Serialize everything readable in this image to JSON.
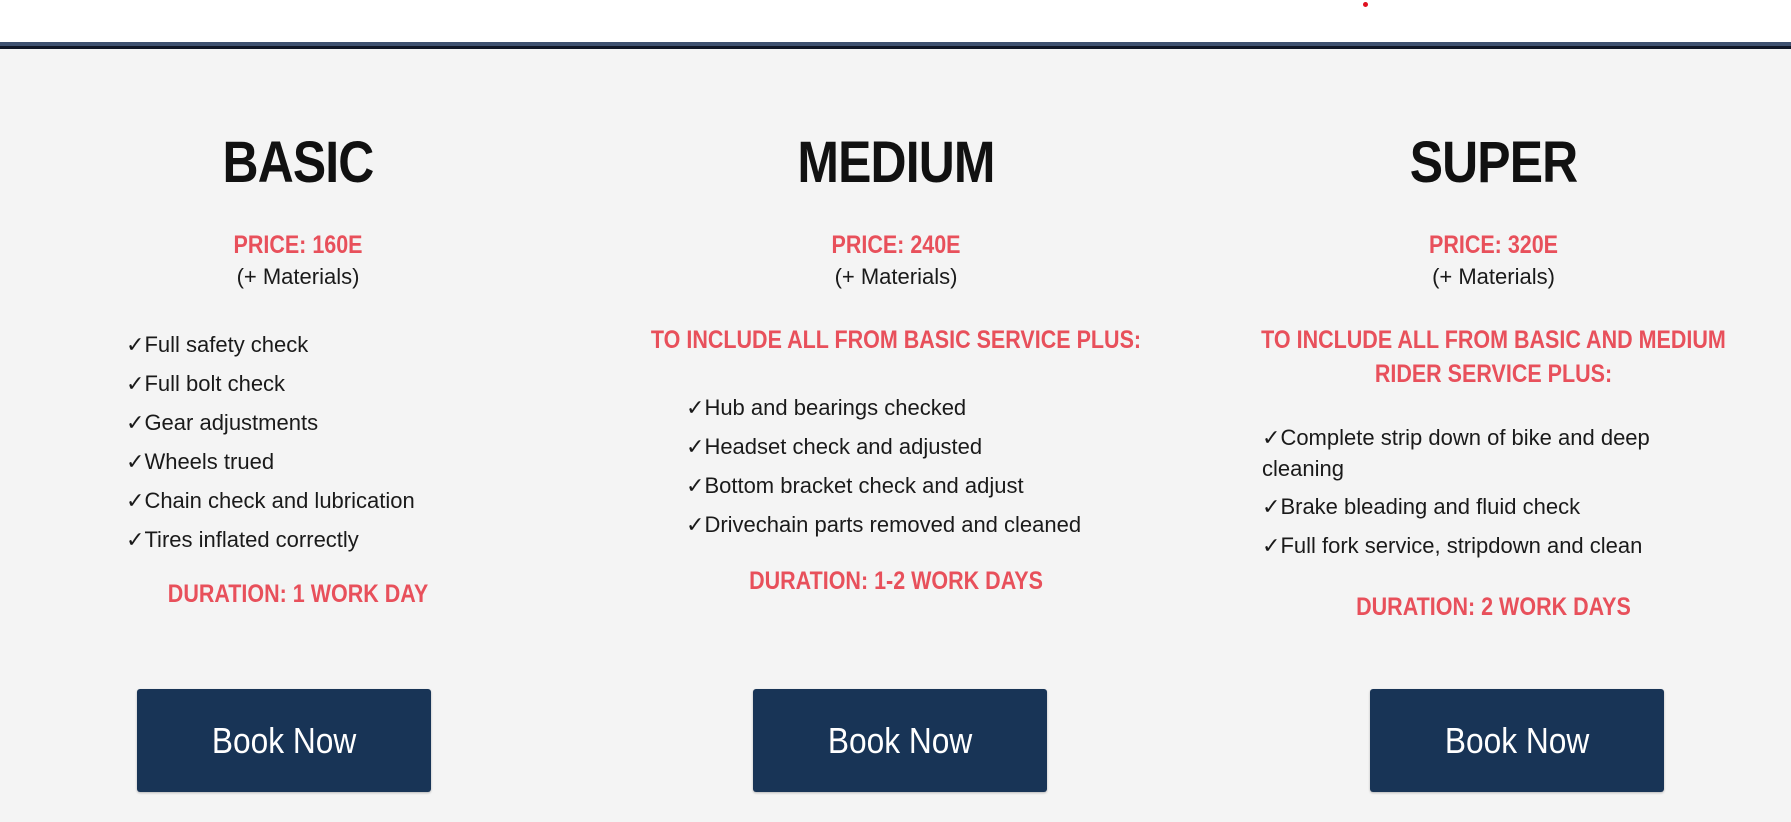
{
  "colors": {
    "accent": "#e8505b",
    "button_bg": "#183456",
    "header_bg": "#ffffff",
    "header_line": "#3e5170",
    "page_bg": "#f4f4f4",
    "dot": "#e01020"
  },
  "check_icon": "check-icon",
  "check_glyph": "✓",
  "plans": [
    {
      "name": "BASIC",
      "price": "PRICE: 160E",
      "materials": "(+ Materials)",
      "features": [
        "Full safety check",
        "Full bolt check",
        "Gear adjustments",
        "Wheels trued",
        "Chain check and lubrication",
        "Tires inflated correctly"
      ],
      "duration": "DURATION: 1 WORK DAY",
      "button_label": "Book Now"
    },
    {
      "name": "MEDIUM",
      "price": "PRICE: 240E",
      "materials": "(+ Materials)",
      "include": "TO INCLUDE ALL FROM BASIC SERVICE PLUS:",
      "features": [
        "Hub and bearings checked",
        "Headset check and adjusted",
        "Bottom bracket check and adjust",
        "Drivechain parts removed and cleaned"
      ],
      "duration": "DURATION: 1-2 WORK DAYS",
      "button_label": "Book Now"
    },
    {
      "name": "SUPER",
      "price": "PRICE: 320E",
      "materials": "(+ Materials)",
      "include": "TO INCLUDE ALL FROM BASIC AND MEDIUM RIDER SERVICE PLUS:",
      "features": [
        "Complete strip down of bike and deep cleaning",
        "Brake bleading and fluid check",
        "Full fork service, stripdown and clean"
      ],
      "duration": "DURATION: 2 WORK DAYS",
      "button_label": "Book Now"
    }
  ]
}
